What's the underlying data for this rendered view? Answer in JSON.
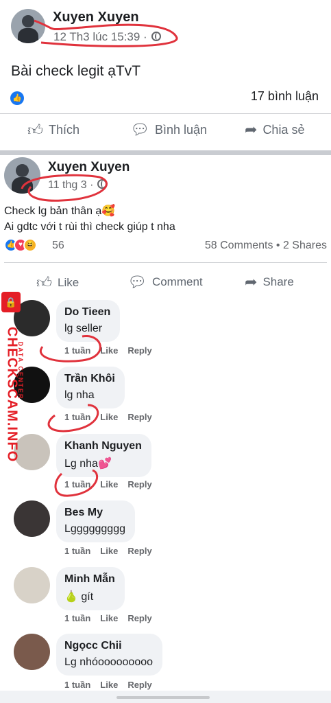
{
  "post1": {
    "author": "Xuyen Xuyen",
    "time": "12 Th3 lúc 15:39 ·",
    "text": "Bài check legit ạTvT",
    "comment_count": "17 bình luận",
    "actions": {
      "like": "Thích",
      "comment": "Bình luận",
      "share": "Chia sẻ"
    }
  },
  "post2": {
    "author": "Xuyen Xuyen",
    "time": "11 thg 3 ·",
    "text_line1": "Check lg bản thân ạ🥰",
    "text_line2": "Ai gdtc với t rùi thì check giúp t nha",
    "reaction_count": "56",
    "stats": "58 Comments • 2 Shares",
    "actions": {
      "like": "Like",
      "comment": "Comment",
      "share": "Share"
    }
  },
  "comment_meta": {
    "time": "1 tuần",
    "like": "Like",
    "reply": "Reply"
  },
  "comments": [
    {
      "name": "Do Tieen",
      "text": "lg seller"
    },
    {
      "name": "Trần Khôi",
      "text": "lg nha"
    },
    {
      "name": "Khanh Nguyen",
      "text": "Lg nha💕"
    },
    {
      "name": "Bes My",
      "text": "Lggggggggg"
    },
    {
      "name": "Minh Mẫn",
      "text": "🍐 gít"
    },
    {
      "name": "Ngọcc Chii",
      "text": "Lg nhóooooooooo"
    }
  ],
  "watermark": {
    "brand": "CHECKSCAM.INFO",
    "sub": "DATA CENTER"
  },
  "colors": {
    "accent": "#1877f2",
    "annotation": "#e0323c",
    "watermark": "#e41e26"
  }
}
